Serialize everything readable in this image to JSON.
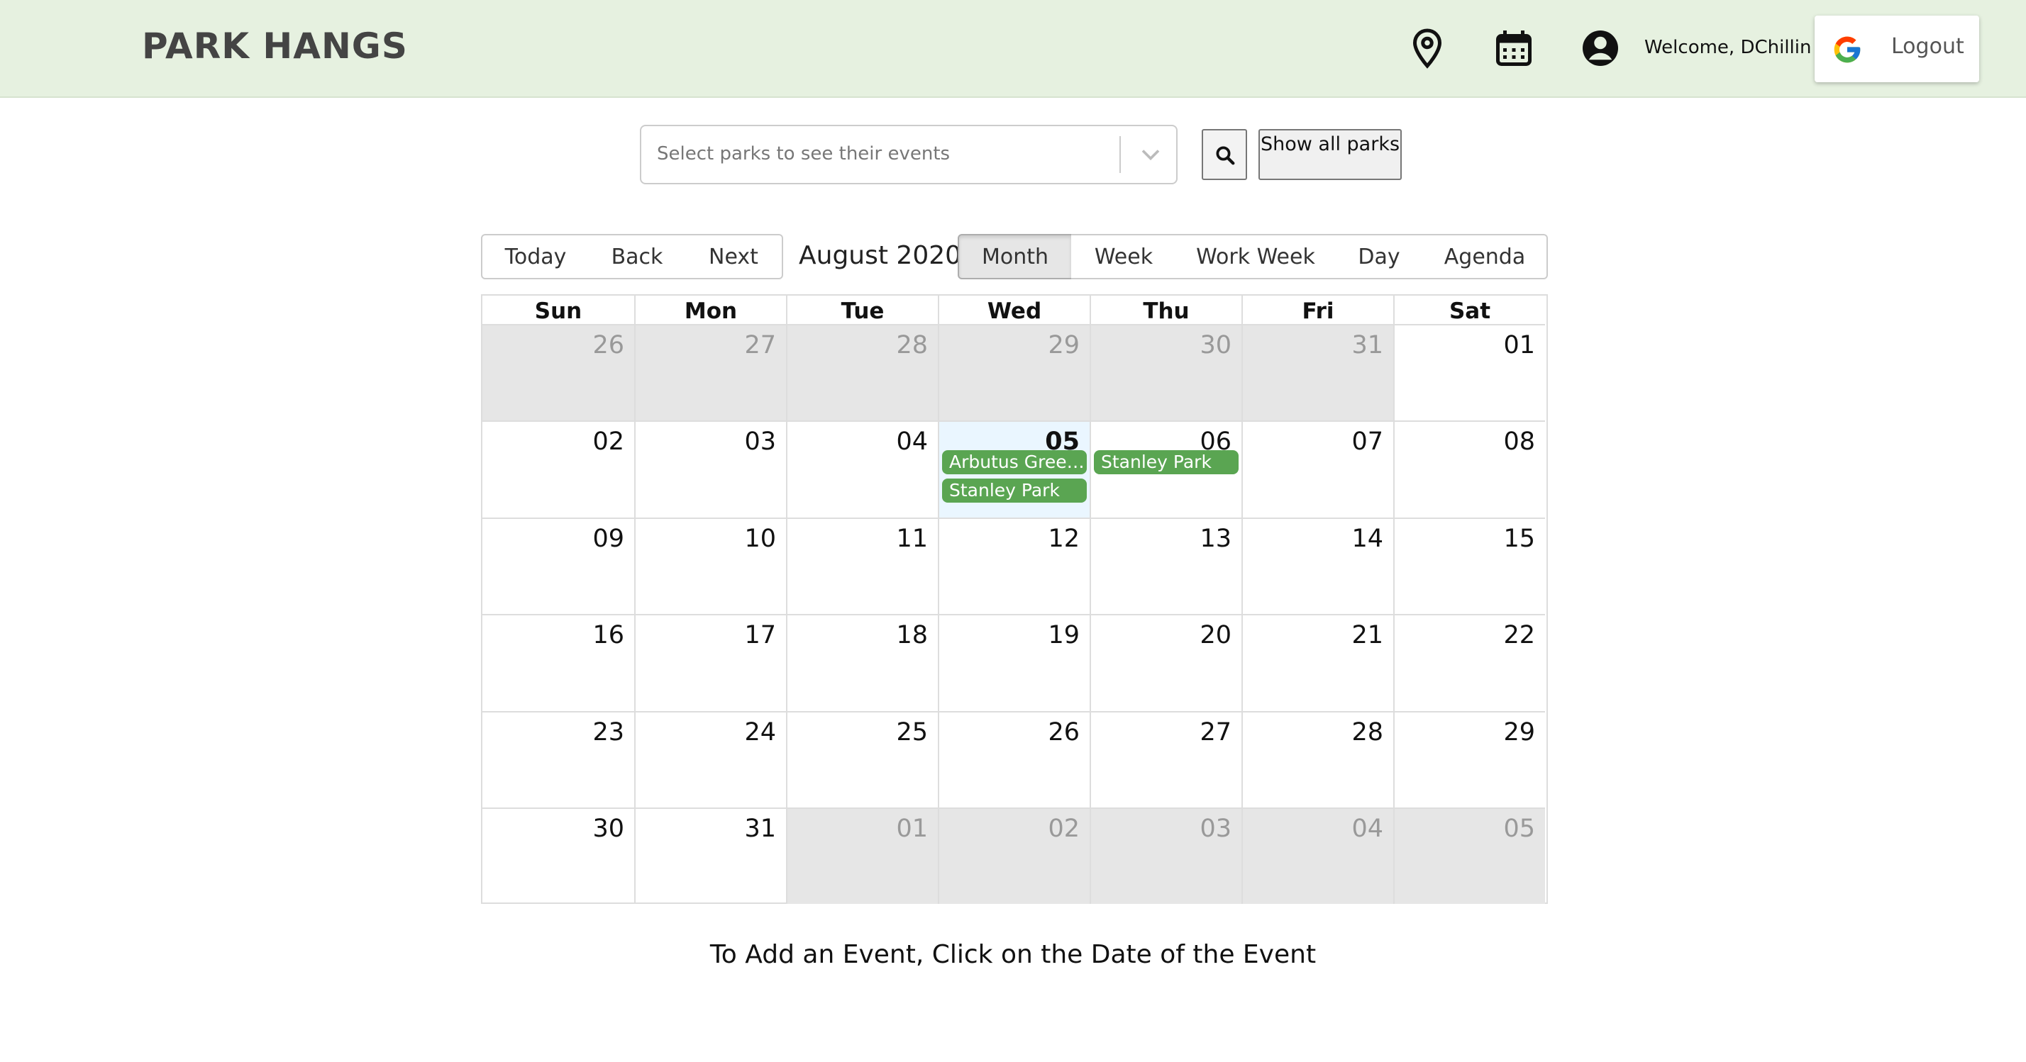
{
  "header": {
    "brand": "PARK HANGS",
    "icons": [
      "map-pin-icon",
      "calendar-icon",
      "account-icon"
    ],
    "welcome": "Welcome, DChillin",
    "logout_label": "Logout"
  },
  "search": {
    "placeholder": "Select parks to see their events",
    "show_all_label": "Show all parks"
  },
  "toolbar": {
    "today": "Today",
    "back": "Back",
    "next": "Next",
    "label": "August 2020",
    "views": [
      "Month",
      "Week",
      "Work Week",
      "Day",
      "Agenda"
    ],
    "active_view": "Month"
  },
  "calendar": {
    "weekdays": [
      "Sun",
      "Mon",
      "Tue",
      "Wed",
      "Thu",
      "Fri",
      "Sat"
    ],
    "weeks": [
      [
        "26",
        "27",
        "28",
        "29",
        "30",
        "31",
        "01"
      ],
      [
        "02",
        "03",
        "04",
        "05",
        "06",
        "07",
        "08"
      ],
      [
        "09",
        "10",
        "11",
        "12",
        "13",
        "14",
        "15"
      ],
      [
        "16",
        "17",
        "18",
        "19",
        "20",
        "21",
        "22"
      ],
      [
        "23",
        "24",
        "25",
        "26",
        "27",
        "28",
        "29"
      ],
      [
        "30",
        "31",
        "01",
        "02",
        "03",
        "04",
        "05"
      ]
    ],
    "today": "05",
    "events": [
      {
        "day": "05",
        "title": "Arbutus Greenway"
      },
      {
        "day": "05",
        "title": "Stanley Park"
      },
      {
        "day": "06",
        "title": "Stanley Park"
      }
    ],
    "event_color": "#5aa552"
  },
  "footer": {
    "note": "To Add an Event, Click on the Date of the Event"
  }
}
